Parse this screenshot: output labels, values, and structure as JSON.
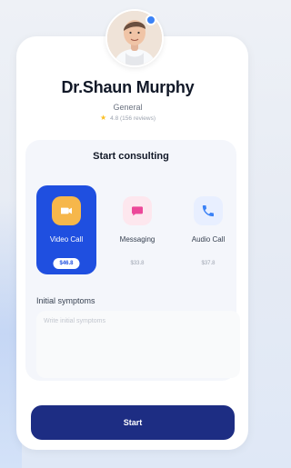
{
  "doctor": {
    "name": "Dr.Shaun Murphy",
    "specialty": "General",
    "rating_text": "4.8 (156 reviews)",
    "star_icon": "star-icon"
  },
  "consulting": {
    "title": "Start consulting",
    "modes": [
      {
        "label": "Video Call",
        "price": "$46.8",
        "icon": "video-icon",
        "selected": true
      },
      {
        "label": "Messaging",
        "price": "$33.8",
        "icon": "message-icon",
        "selected": false
      },
      {
        "label": "Audio Call",
        "price": "$37.8",
        "icon": "phone-icon",
        "selected": false
      }
    ]
  },
  "symptoms": {
    "label": "Initial symptoms",
    "placeholder": "Write initial symptoms"
  },
  "actions": {
    "start_label": "Start"
  },
  "colors": {
    "primary": "#1f4fe0",
    "start_button": "#1d2d83",
    "video_icon_bg": "#f6b74b",
    "message_icon_bg": "#fde7ee",
    "phone_icon_bg": "#e8efff"
  }
}
